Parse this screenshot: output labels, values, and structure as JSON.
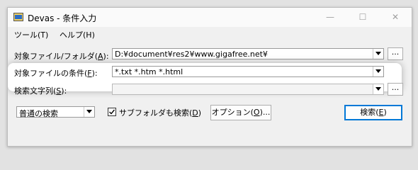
{
  "window": {
    "title": "Devas - 条件入力",
    "minimize": "—",
    "maximize": "☐",
    "close": "✕"
  },
  "menu": {
    "items": [
      "ツール(T)",
      "ヘルプ(H)"
    ]
  },
  "form": {
    "target_label": "対象ファイル/フォルダ(",
    "target_key": "A",
    "target_close": "):",
    "target_value": "D:¥document¥res2¥www.gigafree.net¥",
    "condition_label": "対象ファイルの条件(",
    "condition_key": "F",
    "condition_close": "):",
    "condition_value": "*.txt *.htm *.html",
    "search_label": "検索文字列(",
    "search_key": "S",
    "search_close": "):",
    "search_value": "",
    "browse": "...",
    "mode_value": "普通の検索",
    "subfolder_label": "サブフォルダも検索(",
    "subfolder_key": "D",
    "subfolder_close": ")",
    "subfolder_checked": "✓",
    "options_label": "オプション(",
    "options_key": "O",
    "options_close": ")...",
    "search_button_label": "検索(",
    "search_button_key": "E",
    "search_button_close": ")"
  },
  "colors": {
    "accent": "#0078d7",
    "window_bg": "#f0f0f0",
    "highlight": "#ffffff"
  }
}
